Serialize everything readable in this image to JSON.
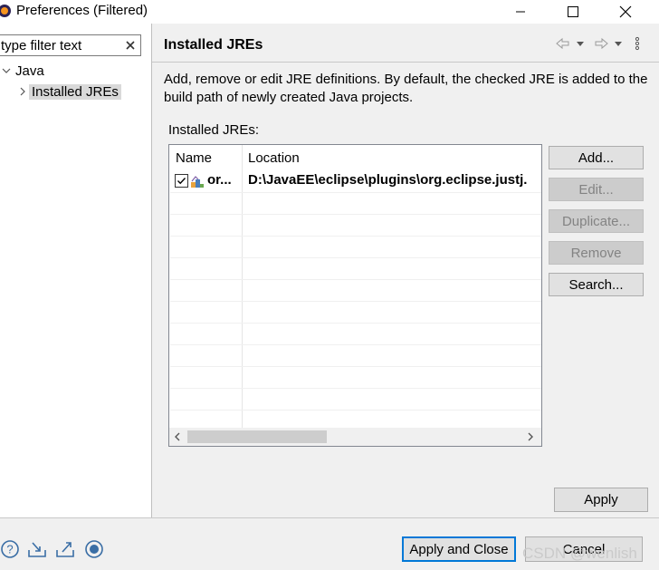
{
  "window": {
    "title": "Preferences (Filtered)"
  },
  "filter": {
    "placeholder": "type filter text"
  },
  "tree": {
    "items": [
      {
        "label": "Java"
      },
      {
        "label": "Installed JREs"
      }
    ]
  },
  "page": {
    "title": "Installed JREs",
    "description": "Add, remove or edit JRE definitions. By default, the checked JRE is added to the build path of newly created Java projects.",
    "list_label": "Installed JREs:"
  },
  "table": {
    "columns": [
      "Name",
      "Location"
    ],
    "rows": [
      {
        "checked": true,
        "name": "or...",
        "location": "D:\\JavaEE\\eclipse\\plugins\\org.eclipse.justj."
      }
    ]
  },
  "buttons": {
    "add": "Add...",
    "edit": "Edit...",
    "duplicate": "Duplicate...",
    "remove": "Remove",
    "search": "Search...",
    "apply": "Apply",
    "apply_and_close": "Apply and Close",
    "cancel": "Cancel"
  },
  "watermark": "CSDN @wenlish",
  "icons": [
    "eclipse-icon",
    "help-icon",
    "import-icon",
    "export-icon",
    "record-icon",
    "jre-icon"
  ]
}
